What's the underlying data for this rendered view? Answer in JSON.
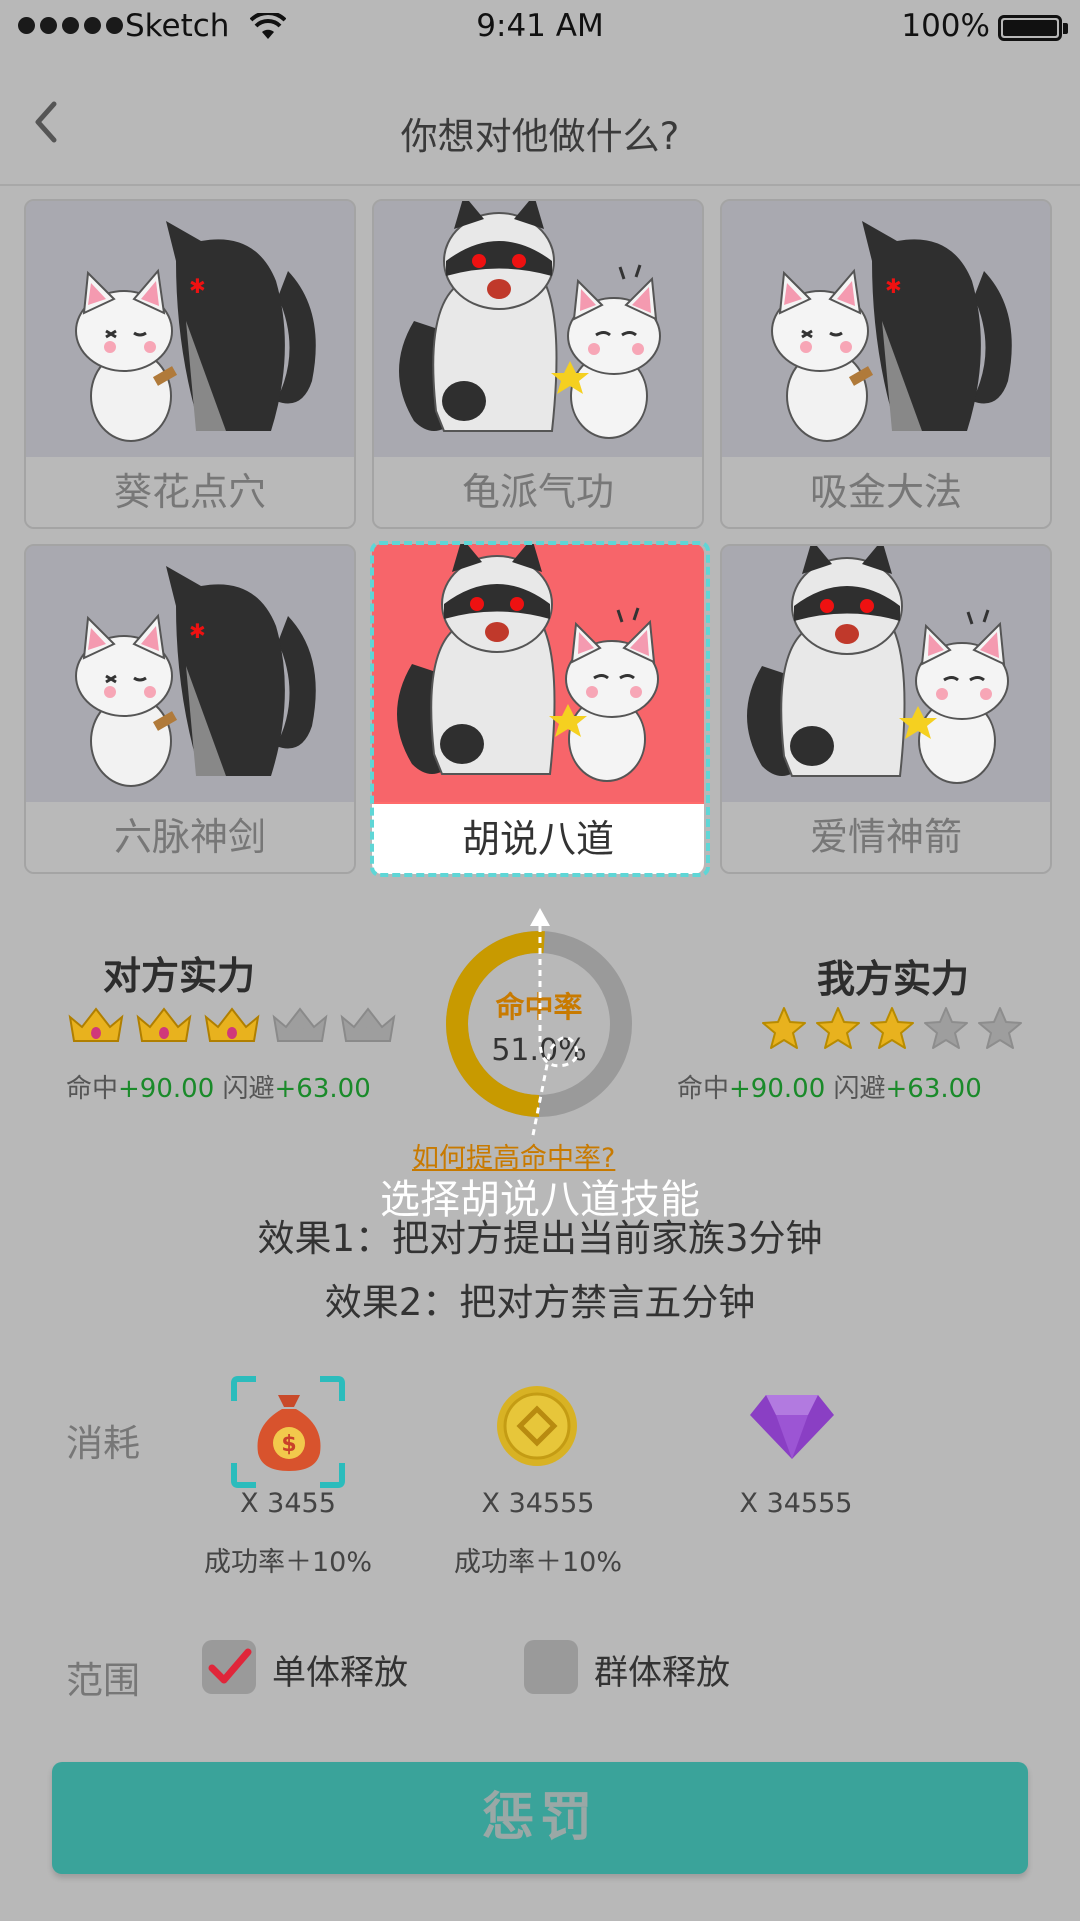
{
  "status_bar": {
    "carrier": "Sketch",
    "time": "9:41 AM",
    "battery": "100%"
  },
  "nav": {
    "title": "你想对他做什么?"
  },
  "skills": [
    {
      "name": "葵花点穴",
      "scene": "dog-poke",
      "selected": false
    },
    {
      "name": "龟派气功",
      "scene": "dog-angry",
      "selected": false
    },
    {
      "name": "吸金大法",
      "scene": "dog-poke",
      "selected": false
    },
    {
      "name": "六脉神剑",
      "scene": "dog-poke",
      "selected": false
    },
    {
      "name": "胡说八道",
      "scene": "dog-angry",
      "selected": true
    },
    {
      "name": "爱情神箭",
      "scene": "dog-angry",
      "selected": false
    }
  ],
  "opponent": {
    "title": "对方实力",
    "rating_icon": "crown-icon",
    "rating": 3,
    "rating_max": 5,
    "hit_label": "命中",
    "hit_value": "+90.00",
    "dodge_label": "闪避",
    "dodge_value": "+63.00"
  },
  "self": {
    "title": "我方实力",
    "rating_icon": "star-icon",
    "rating": 3,
    "rating_max": 5,
    "hit_label": "命中",
    "hit_value": "+90.00",
    "dodge_label": "闪避",
    "dodge_value": "+63.00"
  },
  "hit_rate": {
    "label": "命中率",
    "value": "51.0%",
    "fraction": 0.51
  },
  "help_link": "如何提高命中率?",
  "tip": "选择胡说八道技能",
  "effects": [
    "效果1：把对方提出当前家族3分钟",
    "效果2：把对方禁言五分钟"
  ],
  "cost": {
    "label": "消耗",
    "items": [
      {
        "icon": "money-bag-icon",
        "qty": "X 3455",
        "bonus": "成功率＋10%",
        "selected": true
      },
      {
        "icon": "gold-coin-icon",
        "qty": "X 34555",
        "bonus": "成功率＋10%",
        "selected": false
      },
      {
        "icon": "diamond-icon",
        "qty": "X 34555",
        "bonus": "",
        "selected": false
      }
    ]
  },
  "range": {
    "label": "范围",
    "options": [
      {
        "label": "单体释放",
        "checked": true
      },
      {
        "label": "群体释放",
        "checked": false
      }
    ]
  },
  "punish_button": "惩罚",
  "colors": {
    "accent": "#3aa39a",
    "selected_card": "#f7656a",
    "highlight": "#c87a00",
    "plus": "#1a8a2a"
  }
}
